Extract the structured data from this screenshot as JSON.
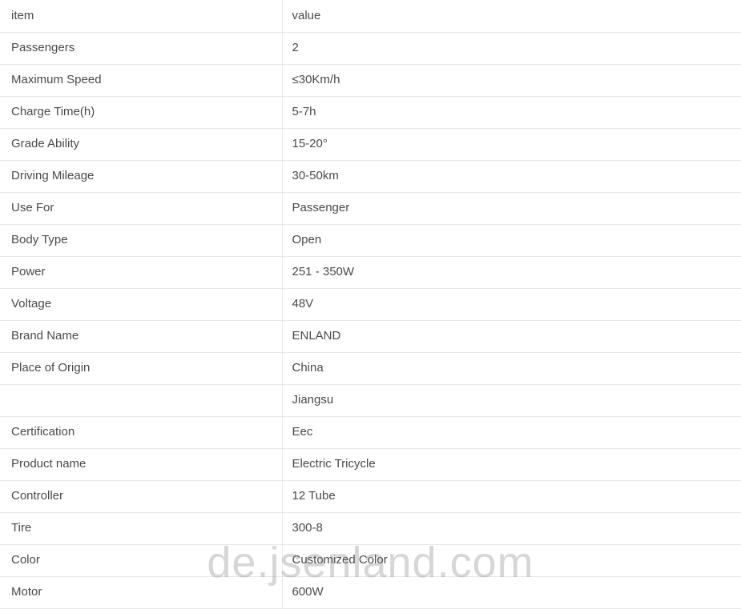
{
  "table": {
    "headers": {
      "item": "item",
      "value": "value"
    },
    "rows": [
      {
        "item": "Passengers",
        "value": "2"
      },
      {
        "item": "Maximum Speed",
        "value": "≤30Km/h"
      },
      {
        "item": "Charge Time(h)",
        "value": "5-7h"
      },
      {
        "item": "Grade Ability",
        "value": "15-20°"
      },
      {
        "item": "Driving Mileage",
        "value": "30-50km"
      },
      {
        "item": "Use For",
        "value": "Passenger"
      },
      {
        "item": "Body Type",
        "value": "Open"
      },
      {
        "item": "Power",
        "value": "251 - 350W"
      },
      {
        "item": "Voltage",
        "value": "48V"
      },
      {
        "item": "Brand Name",
        "value": "ENLAND"
      },
      {
        "item": "Place of Origin",
        "value": "China"
      },
      {
        "item": "",
        "value": "Jiangsu"
      },
      {
        "item": "Certification",
        "value": "Eec"
      },
      {
        "item": "Product name",
        "value": "Electric Tricycle"
      },
      {
        "item": "Controller",
        "value": "12 Tube"
      },
      {
        "item": "Tire",
        "value": "300-8"
      },
      {
        "item": "Color",
        "value": "Customized Color"
      },
      {
        "item": "Motor",
        "value": "600W"
      }
    ]
  },
  "watermark": {
    "text": "de.jsenland.com"
  }
}
